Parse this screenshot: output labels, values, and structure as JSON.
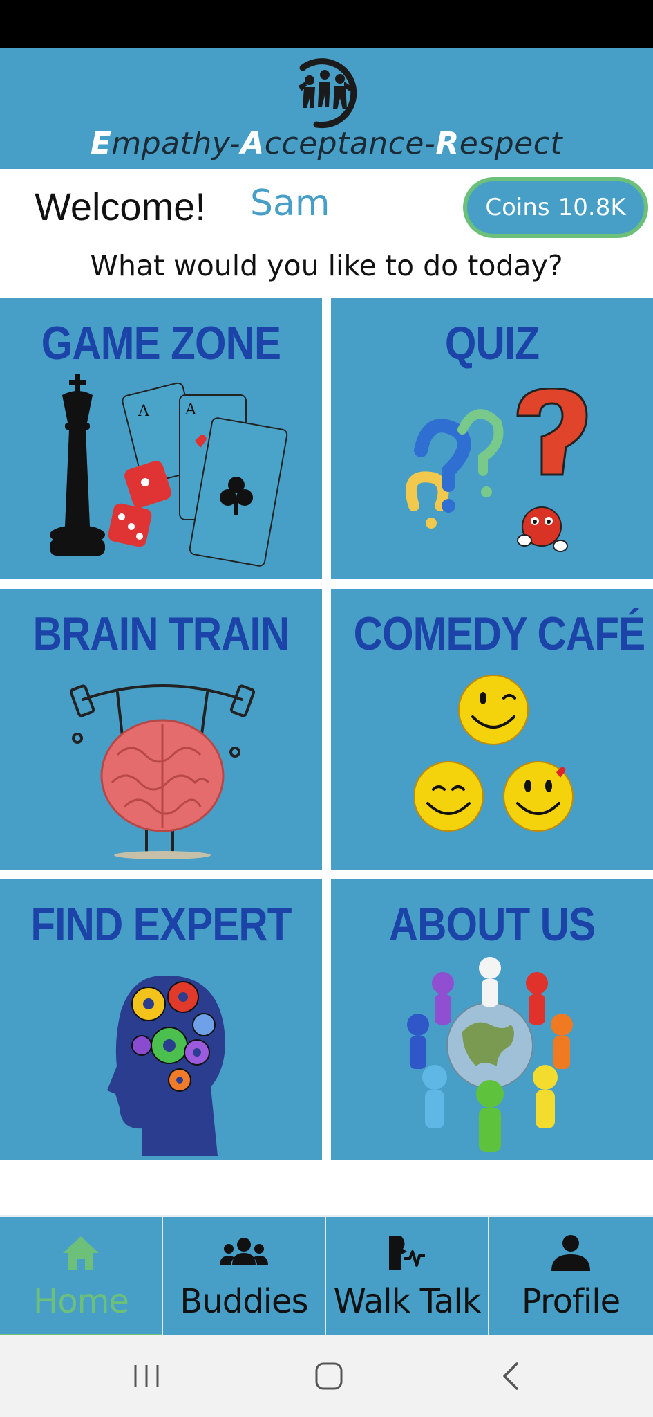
{
  "header": {
    "logo_icon": "three-people-logo-icon",
    "tagline_parts": [
      {
        "cap": "E",
        "rest": "mpathy-"
      },
      {
        "cap": "A",
        "rest": "cceptance-"
      },
      {
        "cap": "R",
        "rest": "espect"
      }
    ]
  },
  "welcome": {
    "greeting": "Welcome!",
    "username": "Sam",
    "coins_label": "Coins",
    "coins_value": "10.8K"
  },
  "prompt": "What would you like to do today?",
  "tiles": [
    {
      "title": "GAME ZONE",
      "icon": "chess-cards-dice-icon"
    },
    {
      "title": "QUIZ",
      "icon": "question-marks-icon"
    },
    {
      "title": "BRAIN TRAIN",
      "icon": "brain-lifting-icon"
    },
    {
      "title": "COMEDY CAFÉ",
      "icon": "smiley-faces-icon"
    },
    {
      "title": "FIND EXPERT",
      "icon": "head-gears-icon"
    },
    {
      "title": "ABOUT US",
      "icon": "people-around-globe-icon"
    }
  ],
  "tabs": [
    {
      "label": "Home",
      "icon": "home-icon",
      "active": true
    },
    {
      "label": "Buddies",
      "icon": "group-icon",
      "active": false
    },
    {
      "label": "Walk Talk",
      "icon": "walk-talk-icon",
      "active": false
    },
    {
      "label": "Profile",
      "icon": "person-icon",
      "active": false
    }
  ],
  "system_nav": {
    "buttons": [
      "recent-apps-icon",
      "home-button-icon",
      "back-icon"
    ]
  },
  "colors": {
    "primary": "#479fc7",
    "title_blue": "#1c43a8",
    "accent_green": "#6cc07a",
    "text_dark": "#111111"
  }
}
